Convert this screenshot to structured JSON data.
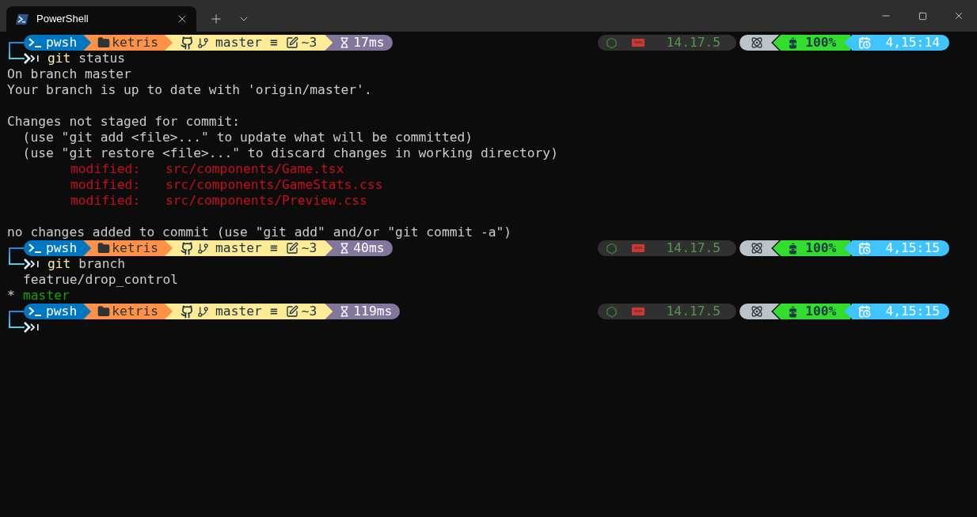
{
  "tab": {
    "title": "PowerShell"
  },
  "blocks": [
    {
      "prompt": {
        "shell": "pwsh",
        "folder": "ketris",
        "branch": "master",
        "branch_status": "≡",
        "changes": "~3",
        "duration": "17ms",
        "node_version": "14.17.5",
        "battery": "100%",
        "time": "4,15:14"
      },
      "command": {
        "program": "git",
        "args": "status"
      },
      "output": [
        {
          "kind": "text",
          "text": "On branch master"
        },
        {
          "kind": "text",
          "text": "Your branch is up to date with 'origin/master'."
        },
        {
          "kind": "blank"
        },
        {
          "kind": "text",
          "text": "Changes not staged for commit:"
        },
        {
          "kind": "text",
          "text": "  (use \"git add <file>...\" to update what will be committed)"
        },
        {
          "kind": "text",
          "text": "  (use \"git restore <file>...\" to discard changes in working directory)"
        },
        {
          "kind": "modified",
          "label": "modified:",
          "path": "src/components/Game.tsx"
        },
        {
          "kind": "modified",
          "label": "modified:",
          "path": "src/components/GameStats.css"
        },
        {
          "kind": "modified",
          "label": "modified:",
          "path": "src/components/Preview.css"
        },
        {
          "kind": "blank"
        },
        {
          "kind": "text",
          "text": "no changes added to commit (use \"git add\" and/or \"git commit -a\")"
        }
      ]
    },
    {
      "prompt": {
        "shell": "pwsh",
        "folder": "ketris",
        "branch": "master",
        "branch_status": "≡",
        "changes": "~3",
        "duration": "40ms",
        "node_version": "14.17.5",
        "battery": "100%",
        "time": "4,15:15"
      },
      "command": {
        "program": "git",
        "args": "branch"
      },
      "output": [
        {
          "kind": "branch",
          "name": "featrue/drop_control",
          "selected": false
        },
        {
          "kind": "branch",
          "marker": "*",
          "name": "master",
          "selected": true
        }
      ]
    },
    {
      "prompt": {
        "shell": "pwsh",
        "folder": "ketris",
        "branch": "master",
        "branch_status": "≡",
        "changes": "~3",
        "duration": "119ms",
        "node_version": "14.17.5",
        "battery": "100%",
        "time": "4,15:15"
      }
    }
  ]
}
